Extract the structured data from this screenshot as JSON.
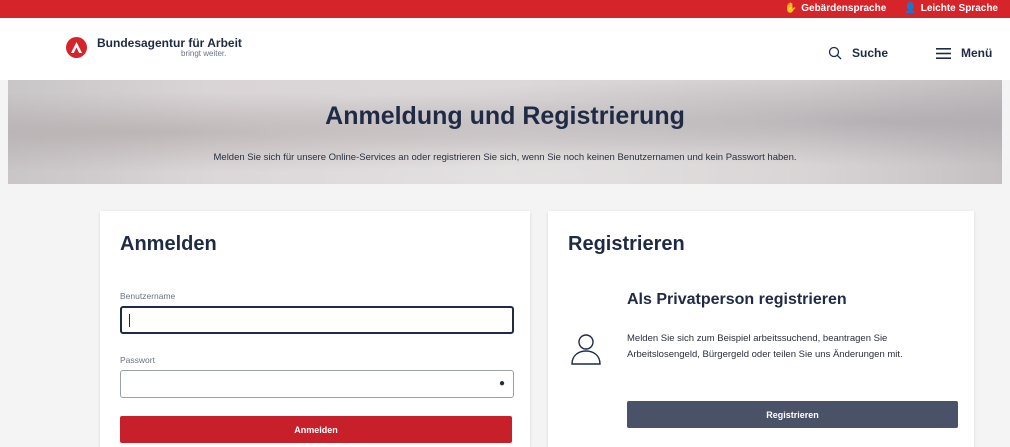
{
  "topbar": {
    "sign_language": "Gebärdensprache",
    "easy_language": "Leichte Sprache"
  },
  "header": {
    "brand_name": "Bundesagentur für Arbeit",
    "brand_tagline": "bringt weiter.",
    "search_label": "Suche",
    "menu_label": "Menü"
  },
  "hero": {
    "title": "Anmeldung und Registrierung",
    "subtitle": "Melden Sie sich für unsere Online-Services an oder registrieren Sie sich, wenn Sie noch keinen Benutzernamen und kein Passwort haben."
  },
  "login": {
    "heading": "Anmelden",
    "username_label": "Benutzername",
    "username_value": "",
    "password_label": "Passwort",
    "password_value": "",
    "submit_label": "Anmelden"
  },
  "register": {
    "heading": "Registrieren",
    "private_heading": "Als Privatperson registrieren",
    "private_desc": "Melden Sie sich zum Beispiel arbeitssuchend, beantragen Sie Arbeitslosengeld, Bürgergeld oder teilen Sie uns Änderungen mit.",
    "submit_label": "Registrieren"
  },
  "colors": {
    "brand_red": "#d6242b",
    "navy": "#1f2a44",
    "button_dark": "#4a5268"
  },
  "icons": {
    "sign_language": "hand-icon",
    "easy_language": "person-reading-icon",
    "search": "search-icon",
    "menu": "hamburger-icon",
    "password_toggle": "eye-icon",
    "private_person": "user-icon"
  }
}
